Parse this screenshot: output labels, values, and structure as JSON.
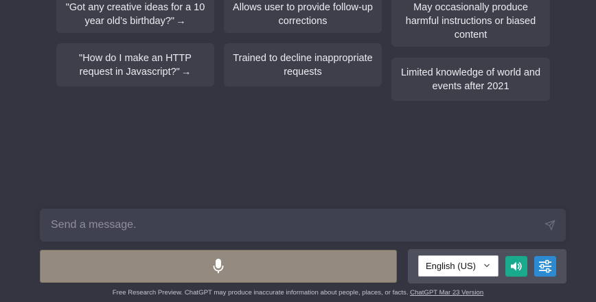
{
  "examples": [
    {
      "text": "\"Got any creative ideas for a 10 year old’s birthday?\"",
      "arrow": "→"
    },
    {
      "text": "\"How do I make an HTTP request in Javascript?\"",
      "arrow": "→"
    }
  ],
  "capabilities": [
    "Allows user to provide follow-up corrections",
    "Trained to decline inappropriate requests"
  ],
  "limitations": [
    "May occasionally produce harmful instructions or biased content",
    "Limited knowledge of world and events after 2021"
  ],
  "composer": {
    "placeholder": "Send a message.",
    "value": ""
  },
  "voice_controls": {
    "language": "English (US)",
    "speaker_color": "#19a98c",
    "settings_color": "#2b8ad0",
    "mic_color": "#948a80"
  },
  "footer": {
    "text": "Free Research Preview. ChatGPT may produce inaccurate information about people, places, or facts.",
    "link": "ChatGPT Mar 23 Version"
  }
}
